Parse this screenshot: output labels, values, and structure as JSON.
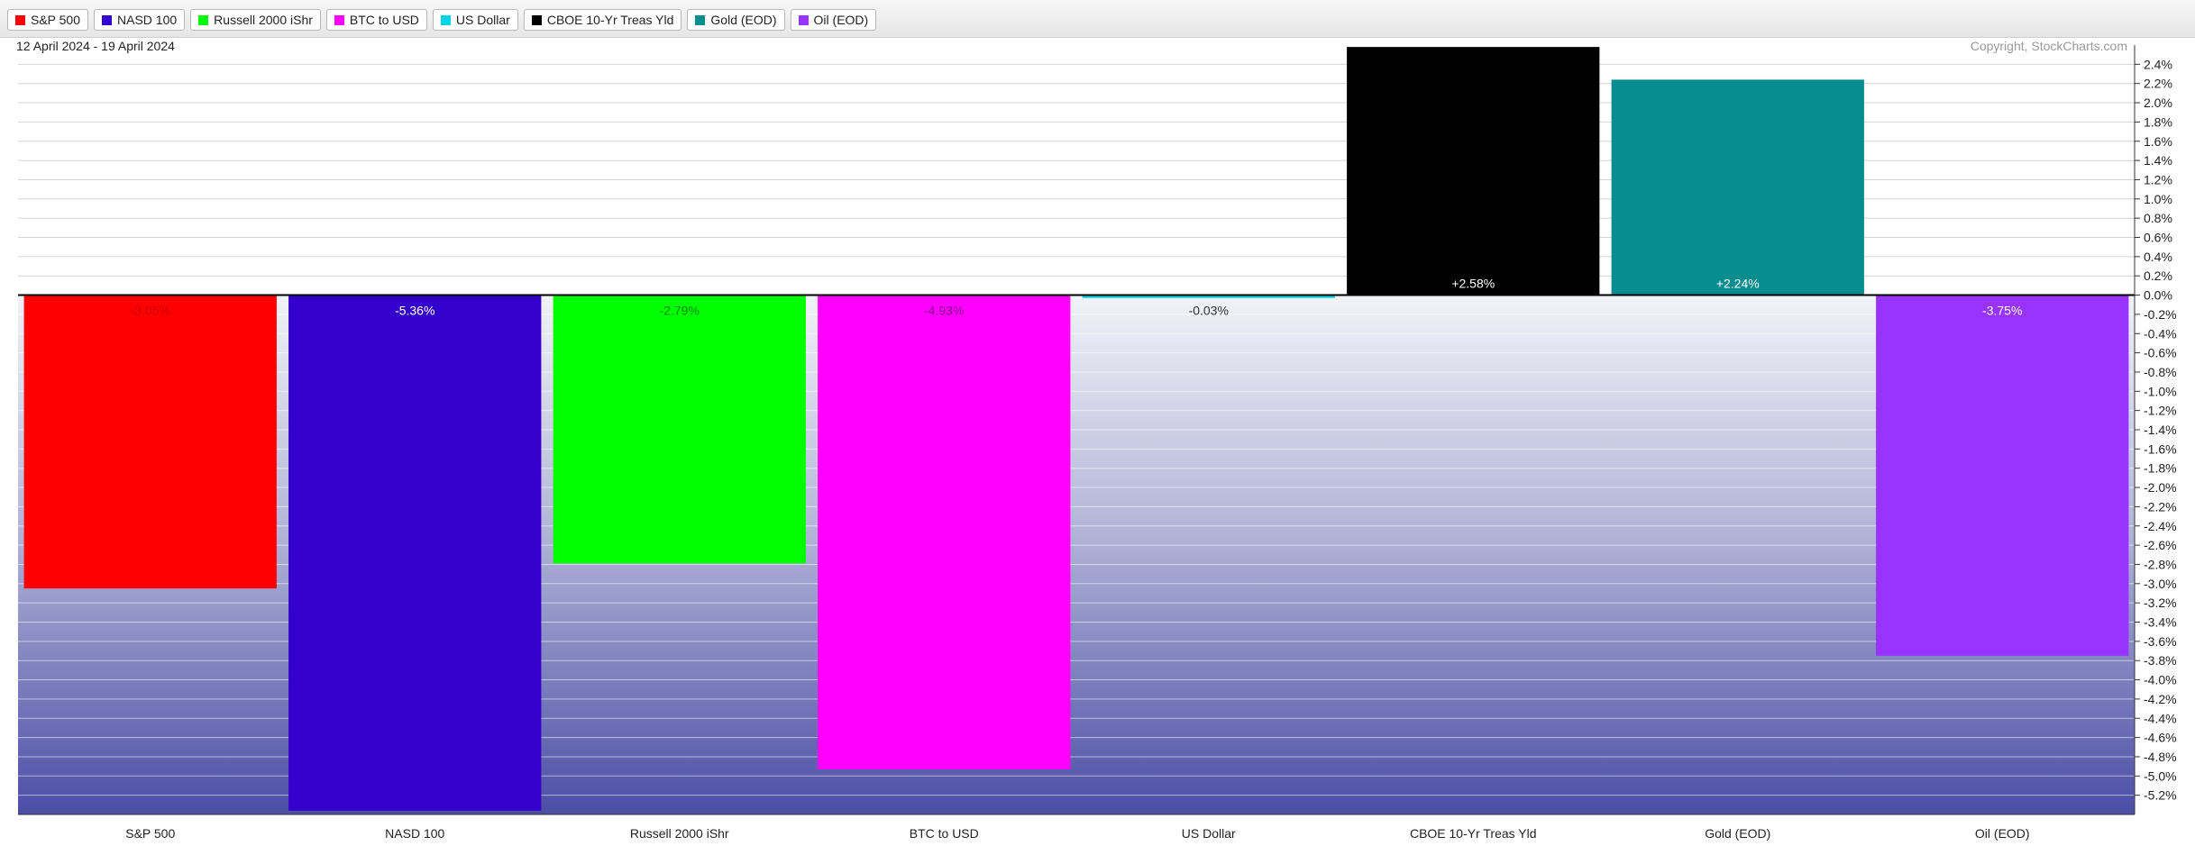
{
  "legend": [
    {
      "label": "S&P 500",
      "color": "#ff0000"
    },
    {
      "label": "NASD 100",
      "color": "#3300cc"
    },
    {
      "label": "Russell 2000 iShr",
      "color": "#00ff00"
    },
    {
      "label": "BTC to USD",
      "color": "#ff00ff"
    },
    {
      "label": "US Dollar",
      "color": "#00d3e6"
    },
    {
      "label": "CBOE 10-Yr Treas Yld",
      "color": "#000000"
    },
    {
      "label": "Gold (EOD)",
      "color": "#078c8f"
    },
    {
      "label": "Oil (EOD)",
      "color": "#9933ff"
    }
  ],
  "chart_data": {
    "type": "bar",
    "date_range": "12 April 2024 - 19 April 2024",
    "copyright": "Copyright, StockCharts.com",
    "categories": [
      "S&P 500",
      "NASD 100",
      "Russell 2000 iShr",
      "BTC to USD",
      "US Dollar",
      "CBOE 10-Yr Treas Yld",
      "Gold (EOD)",
      "Oil (EOD)"
    ],
    "values": [
      -3.05,
      -5.36,
      -2.79,
      -4.93,
      -0.03,
      2.58,
      2.24,
      -3.75
    ],
    "value_labels": [
      "-3.05%",
      "-5.36%",
      "-2.79%",
      "-4.93%",
      "-0.03%",
      "+2.58%",
      "+2.24%",
      "-3.75%"
    ],
    "colors": [
      "#ff0000",
      "#3300cc",
      "#00ff00",
      "#ff00ff",
      "#00d3e6",
      "#000000",
      "#078c8f",
      "#9933ff"
    ],
    "label_colors": [
      "#cc0000",
      "#ffffff",
      "#008800",
      "#880088",
      "#333333",
      "#ffffff",
      "#ffffff",
      "#ffffff"
    ],
    "y_ticks": [
      "2.4%",
      "2.2%",
      "2.0%",
      "1.8%",
      "1.6%",
      "1.4%",
      "1.2%",
      "1.0%",
      "0.8%",
      "0.6%",
      "0.4%",
      "0.2%",
      "0.0%",
      "-0.2%",
      "-0.4%",
      "-0.6%",
      "-0.8%",
      "-1.0%",
      "-1.2%",
      "-1.4%",
      "-1.6%",
      "-1.8%",
      "-2.0%",
      "-2.2%",
      "-2.4%",
      "-2.6%",
      "-2.8%",
      "-3.0%",
      "-3.2%",
      "-3.4%",
      "-3.6%",
      "-3.8%",
      "-4.0%",
      "-4.2%",
      "-4.4%",
      "-4.6%",
      "-4.8%",
      "-5.0%",
      "-5.2%"
    ],
    "ylim": [
      -5.4,
      2.6
    ],
    "grid": true,
    "y_axis_position": "right",
    "ylabel": "",
    "xlabel": ""
  }
}
